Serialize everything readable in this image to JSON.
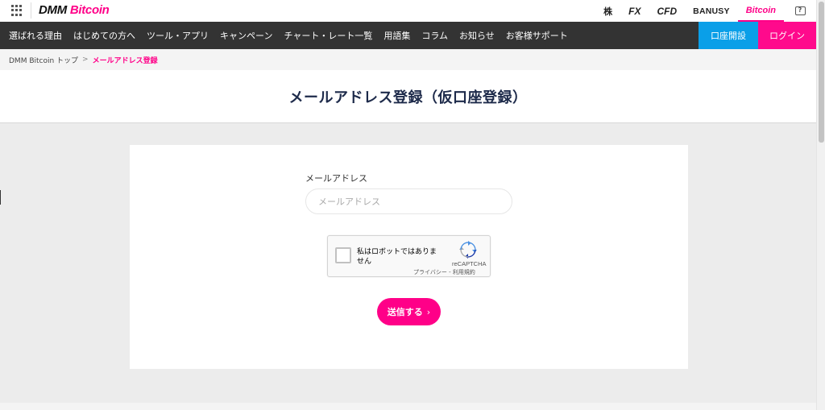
{
  "header": {
    "logo_dmm": "DMM",
    "logo_bitcoin": "Bitcoin",
    "brands": [
      "株",
      "FX",
      "CFD",
      "BANUSY",
      "Bitcoin"
    ],
    "help_glyph": "?"
  },
  "nav": {
    "items": [
      "選ばれる理由",
      "はじめての方へ",
      "ツール・アプリ",
      "キャンペーン",
      "チャート・レート一覧",
      "用語集",
      "コラム",
      "お知らせ",
      "お客様サポート"
    ],
    "open_account": "口座開設",
    "login": "ログイン"
  },
  "breadcrumb": {
    "home": "DMM Bitcoin トップ",
    "separator": ">",
    "current": "メールアドレス登録"
  },
  "page": {
    "title": "メールアドレス登録（仮口座登録）"
  },
  "form": {
    "email_label": "メールアドレス",
    "email_placeholder": "メールアドレス",
    "email_value": "",
    "recaptcha_label": "私はロボットではありません",
    "recaptcha_brand": "reCAPTCHA",
    "recaptcha_terms": "プライバシー - 利用規約",
    "submit_label": "送信する",
    "submit_chevron": "›"
  },
  "colors": {
    "accent": "#ff0088",
    "open_account_bg": "#0a9fe8",
    "nav_bg": "#333333",
    "title": "#1d2a4a"
  }
}
